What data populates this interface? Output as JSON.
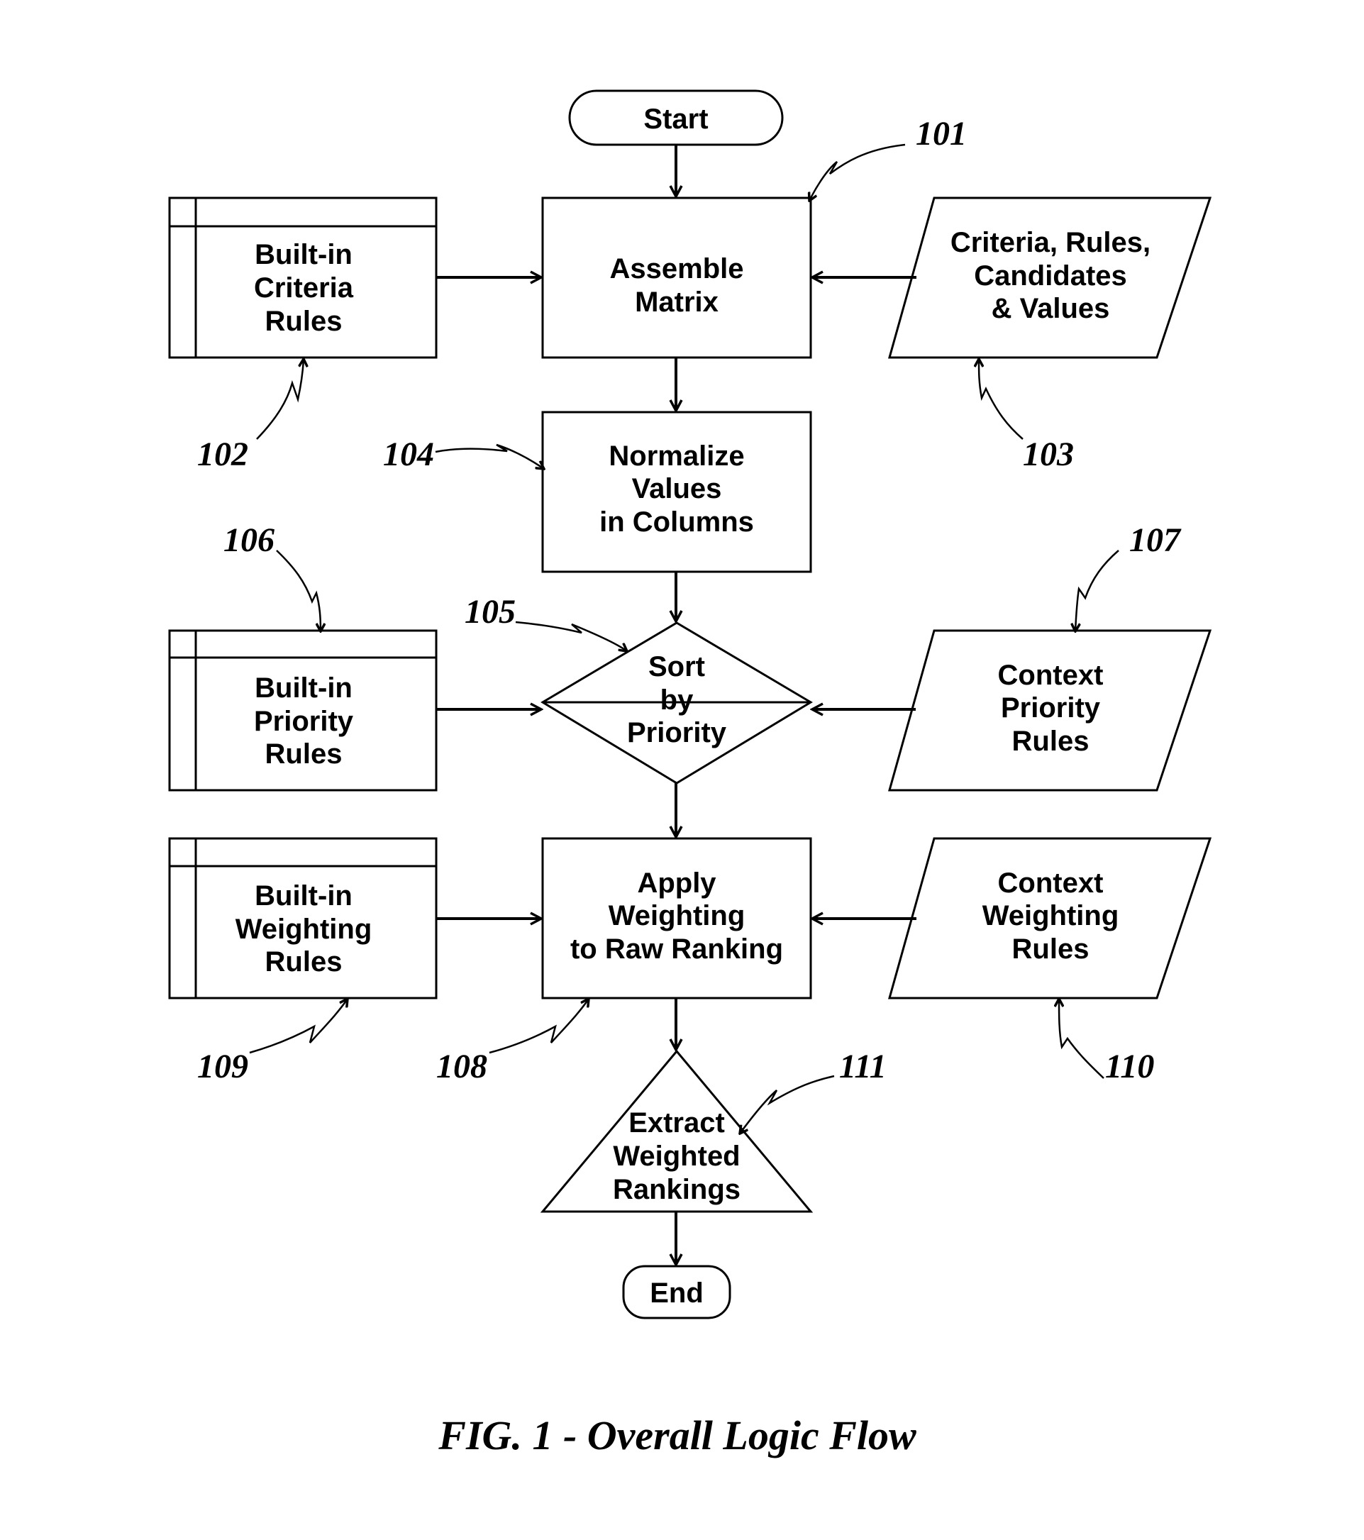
{
  "figure": {
    "caption": "FIG. 1 - Overall Logic Flow"
  },
  "nodes": {
    "start": {
      "type": "terminator",
      "lines": [
        "Start"
      ]
    },
    "assemble_matrix": {
      "type": "process",
      "ref": "101",
      "lines": [
        "Assemble",
        "Matrix"
      ]
    },
    "builtin_criteria_rules": {
      "type": "internal-storage",
      "ref": "102",
      "lines": [
        "Built-in",
        "Criteria",
        "Rules"
      ]
    },
    "criteria_input": {
      "type": "data",
      "ref": "103",
      "lines": [
        "Criteria, Rules,",
        "Candidates",
        "& Values"
      ]
    },
    "normalize_values": {
      "type": "process",
      "ref": "104",
      "lines": [
        "Normalize",
        "Values",
        "in Columns"
      ]
    },
    "sort_by_priority": {
      "type": "sort",
      "ref": "105",
      "lines": [
        "Sort",
        "by",
        "Priority"
      ]
    },
    "builtin_priority_rules": {
      "type": "internal-storage",
      "ref": "106",
      "lines": [
        "Built-in",
        "Priority",
        "Rules"
      ]
    },
    "context_priority_rules": {
      "type": "data",
      "ref": "107",
      "lines": [
        "Context",
        "Priority",
        "Rules"
      ]
    },
    "apply_weighting": {
      "type": "process",
      "ref": "108",
      "lines": [
        "Apply",
        "Weighting",
        "to Raw Ranking"
      ]
    },
    "builtin_weighting_rules": {
      "type": "internal-storage",
      "ref": "109",
      "lines": [
        "Built-in",
        "Weighting",
        "Rules"
      ]
    },
    "context_weighting_rules": {
      "type": "data",
      "ref": "110",
      "lines": [
        "Context",
        "Weighting",
        "Rules"
      ]
    },
    "extract_rankings": {
      "type": "extract",
      "ref": "111",
      "lines": [
        "Extract",
        "Weighted",
        "Rankings"
      ]
    },
    "end": {
      "type": "terminator",
      "lines": [
        "End"
      ]
    }
  },
  "edges": [
    {
      "from": "start",
      "to": "assemble_matrix"
    },
    {
      "from": "builtin_criteria_rules",
      "to": "assemble_matrix"
    },
    {
      "from": "criteria_input",
      "to": "assemble_matrix"
    },
    {
      "from": "assemble_matrix",
      "to": "normalize_values"
    },
    {
      "from": "normalize_values",
      "to": "sort_by_priority"
    },
    {
      "from": "builtin_priority_rules",
      "to": "sort_by_priority"
    },
    {
      "from": "context_priority_rules",
      "to": "sort_by_priority"
    },
    {
      "from": "sort_by_priority",
      "to": "apply_weighting"
    },
    {
      "from": "builtin_weighting_rules",
      "to": "apply_weighting"
    },
    {
      "from": "context_weighting_rules",
      "to": "apply_weighting"
    },
    {
      "from": "apply_weighting",
      "to": "extract_rankings"
    },
    {
      "from": "extract_rankings",
      "to": "end"
    }
  ]
}
